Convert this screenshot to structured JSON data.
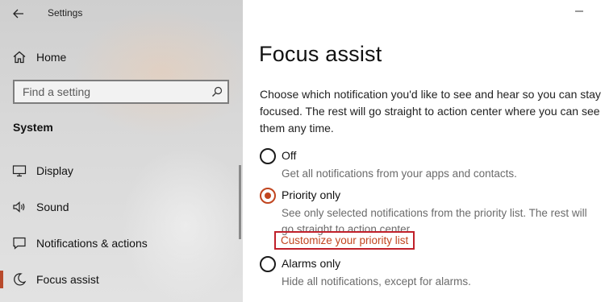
{
  "window": {
    "title": "Settings"
  },
  "sidebar": {
    "home_label": "Home",
    "search_placeholder": "Find a setting",
    "section_title": "System",
    "items": [
      {
        "label": "Display",
        "icon": "display-icon"
      },
      {
        "label": "Sound",
        "icon": "sound-icon"
      },
      {
        "label": "Notifications & actions",
        "icon": "notifications-icon"
      },
      {
        "label": "Focus assist",
        "icon": "focus-assist-icon",
        "active": true
      }
    ]
  },
  "main": {
    "title": "Focus assist",
    "description": "Choose which notification you'd like to see and hear so you can stay focused. The rest will go straight to action center where you can see them any time.",
    "options": [
      {
        "label": "Off",
        "description": "Get all notifications from your apps and contacts.",
        "selected": false
      },
      {
        "label": "Priority only",
        "description": "See only selected notifications from the priority list. The rest will go straight to action center.",
        "selected": true
      },
      {
        "label": "Alarms only",
        "description": "Hide all notifications, except for alarms.",
        "selected": false
      }
    ],
    "customize_link": "Customize your priority list"
  },
  "colors": {
    "accent": "#c1451f",
    "highlight_box": "#c0202a",
    "secondary_text": "#6b6b6b"
  }
}
